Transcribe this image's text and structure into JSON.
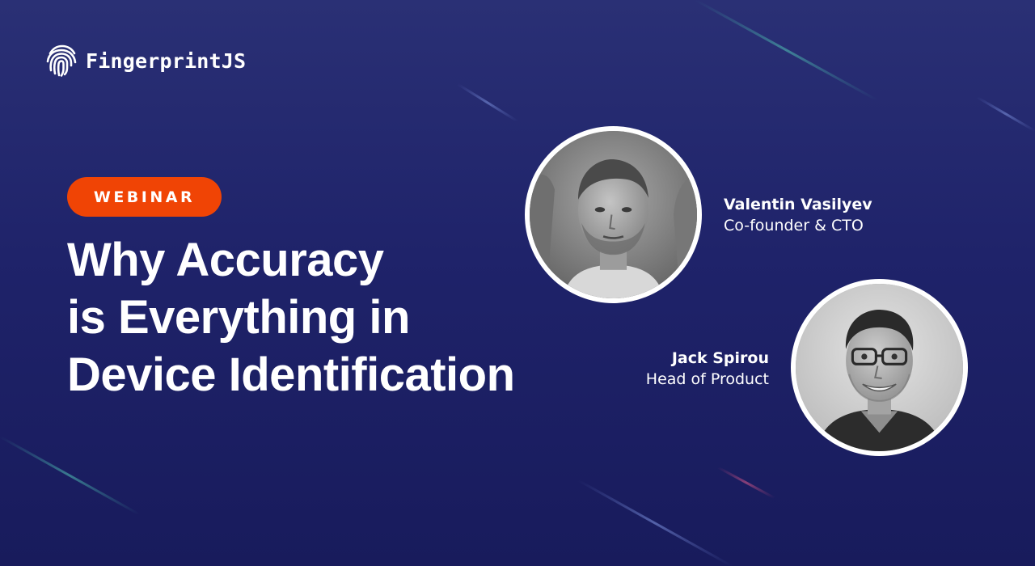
{
  "brand": {
    "name": "FingerprintJS",
    "logo_icon": "fingerprint-icon"
  },
  "badge": {
    "label": "WEBINAR",
    "color": "#f04405"
  },
  "title": {
    "lines": [
      "Why Accuracy",
      "is Everything in",
      "Device Identification"
    ]
  },
  "speakers": [
    {
      "name": "Valentin Vasilyev",
      "role": "Co-founder & CTO"
    },
    {
      "name": "Jack Spirou",
      "role": "Head of Product"
    }
  ],
  "colors": {
    "background": "#1f236a",
    "text": "#ffffff",
    "accent": "#f04405"
  }
}
